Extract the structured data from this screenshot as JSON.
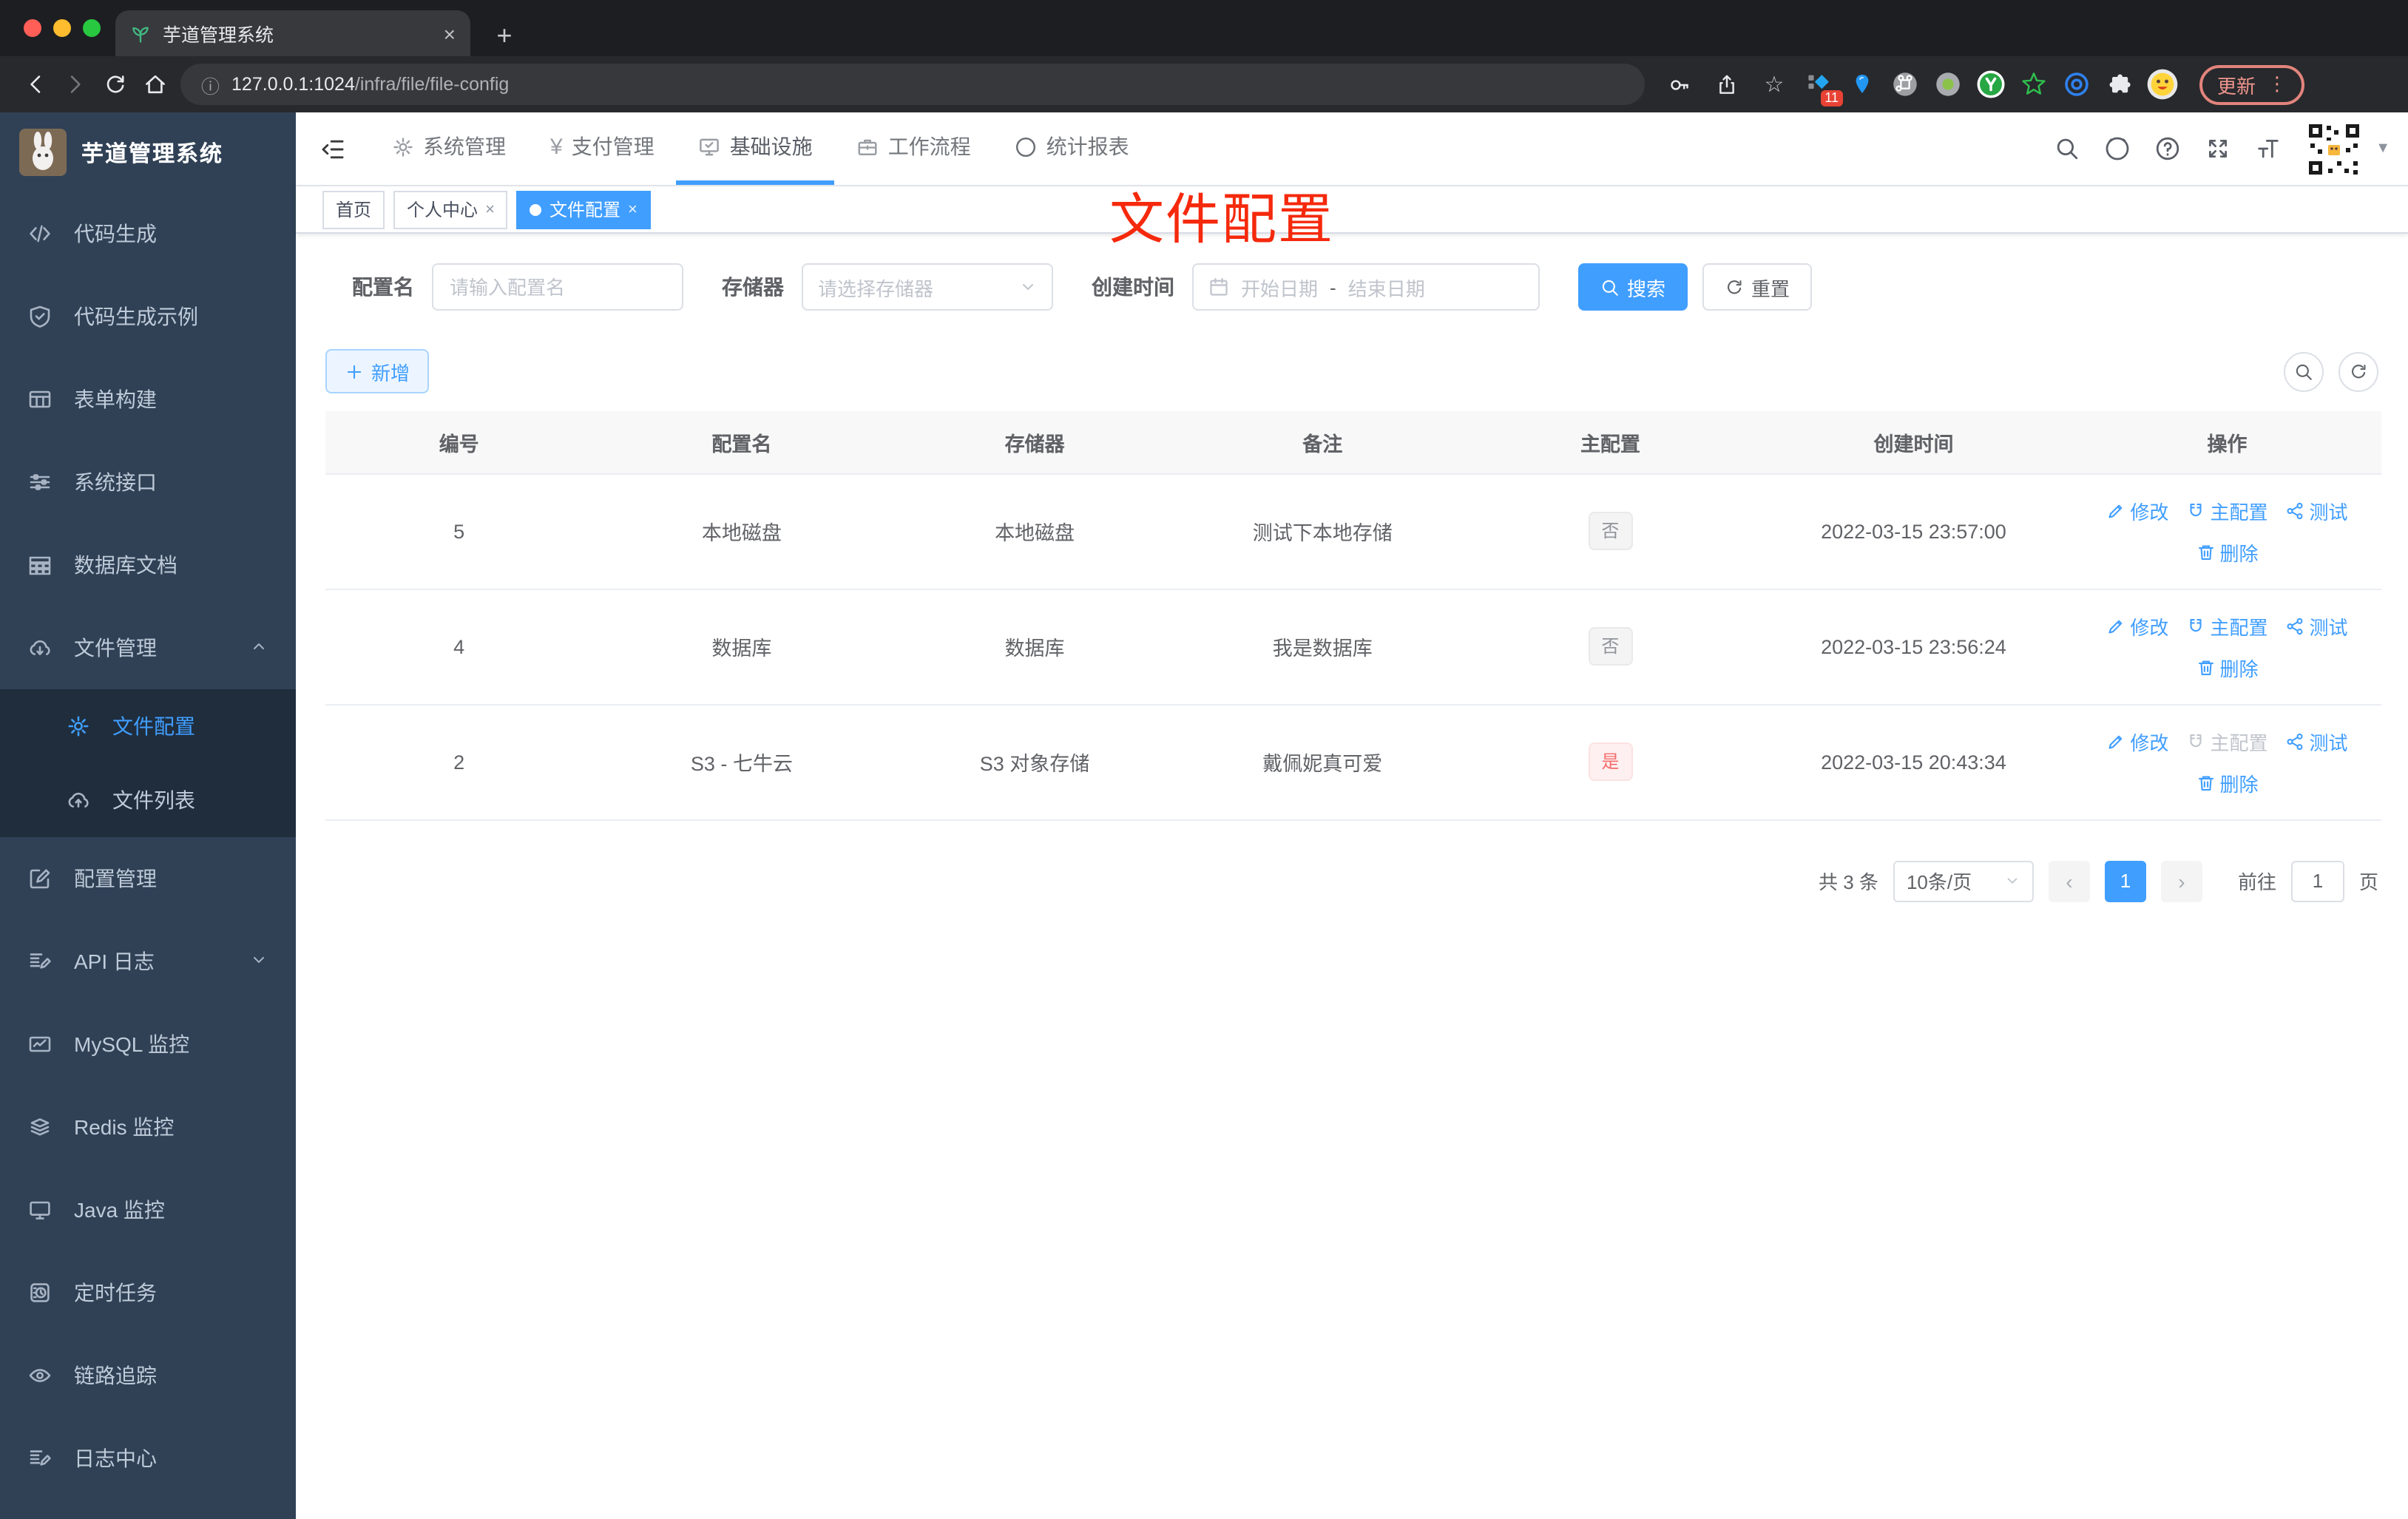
{
  "palette": {
    "accent": "#409eff",
    "sidebar_bg": "#304156",
    "submenu_bg": "#1f2d3d",
    "danger": "#f56c6c",
    "annotation_red": "#f5290c",
    "tag_info_text": "#909399"
  },
  "browser": {
    "tab_title": "芋道管理系统",
    "close_glyph": "×",
    "new_tab_glyph": "+",
    "back_glyph": "←",
    "forward_glyph": "→",
    "info_glyph": "ⓘ",
    "url_host": "127.0.0.1:1024",
    "url_path": "/infra/file/file-config",
    "bookmark_glyph": "☆",
    "ext_badge": "11",
    "cmd_glyph": "⌘",
    "y_glyph": "y",
    "star_glyph": "☆",
    "update_label": "更新",
    "menu_glyph": "⋮"
  },
  "sidebar": {
    "title": "芋道管理系统",
    "items": [
      {
        "label": "代码生成"
      },
      {
        "label": "代码生成示例"
      },
      {
        "label": "表单构建"
      },
      {
        "label": "系统接口"
      },
      {
        "label": "数据库文档"
      },
      {
        "label": "文件管理"
      },
      {
        "label": "配置管理"
      },
      {
        "label": "API 日志"
      },
      {
        "label": "MySQL 监控"
      },
      {
        "label": "Redis 监控"
      },
      {
        "label": "Java 监控"
      },
      {
        "label": "定时任务"
      },
      {
        "label": "链路追踪"
      },
      {
        "label": "日志中心"
      }
    ],
    "submenu": [
      {
        "label": "文件配置"
      },
      {
        "label": "文件列表"
      }
    ]
  },
  "topnav": {
    "items": [
      {
        "label": "系统管理"
      },
      {
        "label": "支付管理"
      },
      {
        "label": "基础设施"
      },
      {
        "label": "工作流程"
      },
      {
        "label": "统计报表"
      }
    ],
    "yen_glyph": "¥"
  },
  "tags": {
    "items": [
      {
        "label": "首页"
      },
      {
        "label": "个人中心"
      },
      {
        "label": "文件配置"
      }
    ],
    "close_glyph": "×"
  },
  "annotation": {
    "text": "文件配置"
  },
  "filters": {
    "name_label": "配置名",
    "name_placeholder": "请输入配置名",
    "storage_label": "存储器",
    "storage_placeholder": "请选择存储器",
    "date_label": "创建时间",
    "date_start_placeholder": "开始日期",
    "date_sep": "-",
    "date_end_placeholder": "结束日期",
    "search_label": "搜索",
    "reset_label": "重置"
  },
  "toolbar": {
    "add_label": "新增"
  },
  "table": {
    "headers": [
      "编号",
      "配置名",
      "存储器",
      "备注",
      "主配置",
      "创建时间",
      "操作"
    ],
    "rows": [
      {
        "id": "5",
        "name": "本地磁盘",
        "storage": "本地磁盘",
        "remark": "测试下本地存储",
        "master": "否",
        "master_type": "info",
        "created": "2022-03-15 23:57:00"
      },
      {
        "id": "4",
        "name": "数据库",
        "storage": "数据库",
        "remark": "我是数据库",
        "master": "否",
        "master_type": "info",
        "created": "2022-03-15 23:56:24"
      },
      {
        "id": "2",
        "name": "S3 - 七牛云",
        "storage": "S3 对象存储",
        "remark": "戴佩妮真可爱",
        "master": "是",
        "master_type": "danger",
        "created": "2022-03-15 20:43:34"
      }
    ]
  },
  "actions": {
    "edit": "修改",
    "master": "主配置",
    "test": "测试",
    "delete": "删除"
  },
  "pagination": {
    "total": "共 3 条",
    "page_size": "10条/页",
    "prev_glyph": "‹",
    "next_glyph": "›",
    "page": "1",
    "goto_label": "前往",
    "goto_value": "1",
    "page_unit": "页"
  }
}
